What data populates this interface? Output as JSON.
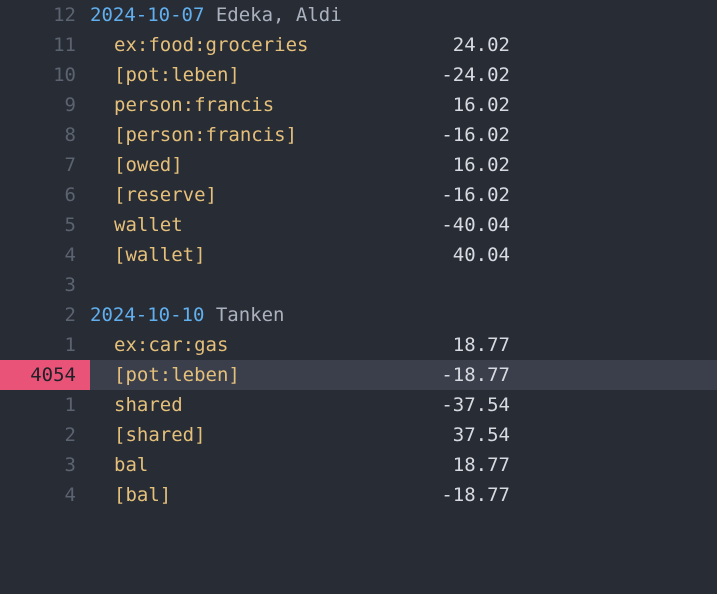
{
  "lines": [
    {
      "gutter": "12",
      "type": "header",
      "date": "2024-10-07",
      "desc": "Edeka, Aldi",
      "highlighted": false,
      "activeGutter": false
    },
    {
      "gutter": "11",
      "type": "posting",
      "account": "ex:food:groceries",
      "amount": "24.02",
      "highlighted": false,
      "activeGutter": false
    },
    {
      "gutter": "10",
      "type": "posting",
      "account": "[pot:leben]",
      "amount": "-24.02",
      "highlighted": false,
      "activeGutter": false
    },
    {
      "gutter": "9",
      "type": "posting",
      "account": "person:francis",
      "amount": "16.02",
      "highlighted": false,
      "activeGutter": false
    },
    {
      "gutter": "8",
      "type": "posting",
      "account": "[person:francis]",
      "amount": "-16.02",
      "highlighted": false,
      "activeGutter": false
    },
    {
      "gutter": "7",
      "type": "posting",
      "account": "[owed]",
      "amount": "16.02",
      "highlighted": false,
      "activeGutter": false
    },
    {
      "gutter": "6",
      "type": "posting",
      "account": "[reserve]",
      "amount": "-16.02",
      "highlighted": false,
      "activeGutter": false
    },
    {
      "gutter": "5",
      "type": "posting",
      "account": "wallet",
      "amount": "-40.04",
      "highlighted": false,
      "activeGutter": false
    },
    {
      "gutter": "4",
      "type": "posting",
      "account": "[wallet]",
      "amount": "40.04",
      "highlighted": false,
      "activeGutter": false
    },
    {
      "gutter": "3",
      "type": "blank",
      "highlighted": false,
      "activeGutter": false
    },
    {
      "gutter": "2",
      "type": "header",
      "date": "2024-10-10",
      "desc": "Tanken",
      "highlighted": false,
      "activeGutter": false
    },
    {
      "gutter": "1",
      "type": "posting",
      "account": "ex:car:gas",
      "amount": "18.77",
      "highlighted": false,
      "activeGutter": false
    },
    {
      "gutter": "4054",
      "type": "posting",
      "account": "[pot:leben]",
      "amount": "-18.77",
      "highlighted": true,
      "activeGutter": true
    },
    {
      "gutter": "1",
      "type": "posting",
      "account": "shared",
      "amount": "-37.54",
      "highlighted": false,
      "activeGutter": false
    },
    {
      "gutter": "2",
      "type": "posting",
      "account": "[shared]",
      "amount": "37.54",
      "highlighted": false,
      "activeGutter": false
    },
    {
      "gutter": "3",
      "type": "posting",
      "account": "bal",
      "amount": "18.77",
      "highlighted": false,
      "activeGutter": false
    },
    {
      "gutter": "4",
      "type": "posting",
      "account": "[bal]",
      "amount": "-18.77",
      "highlighted": false,
      "activeGutter": false
    }
  ]
}
